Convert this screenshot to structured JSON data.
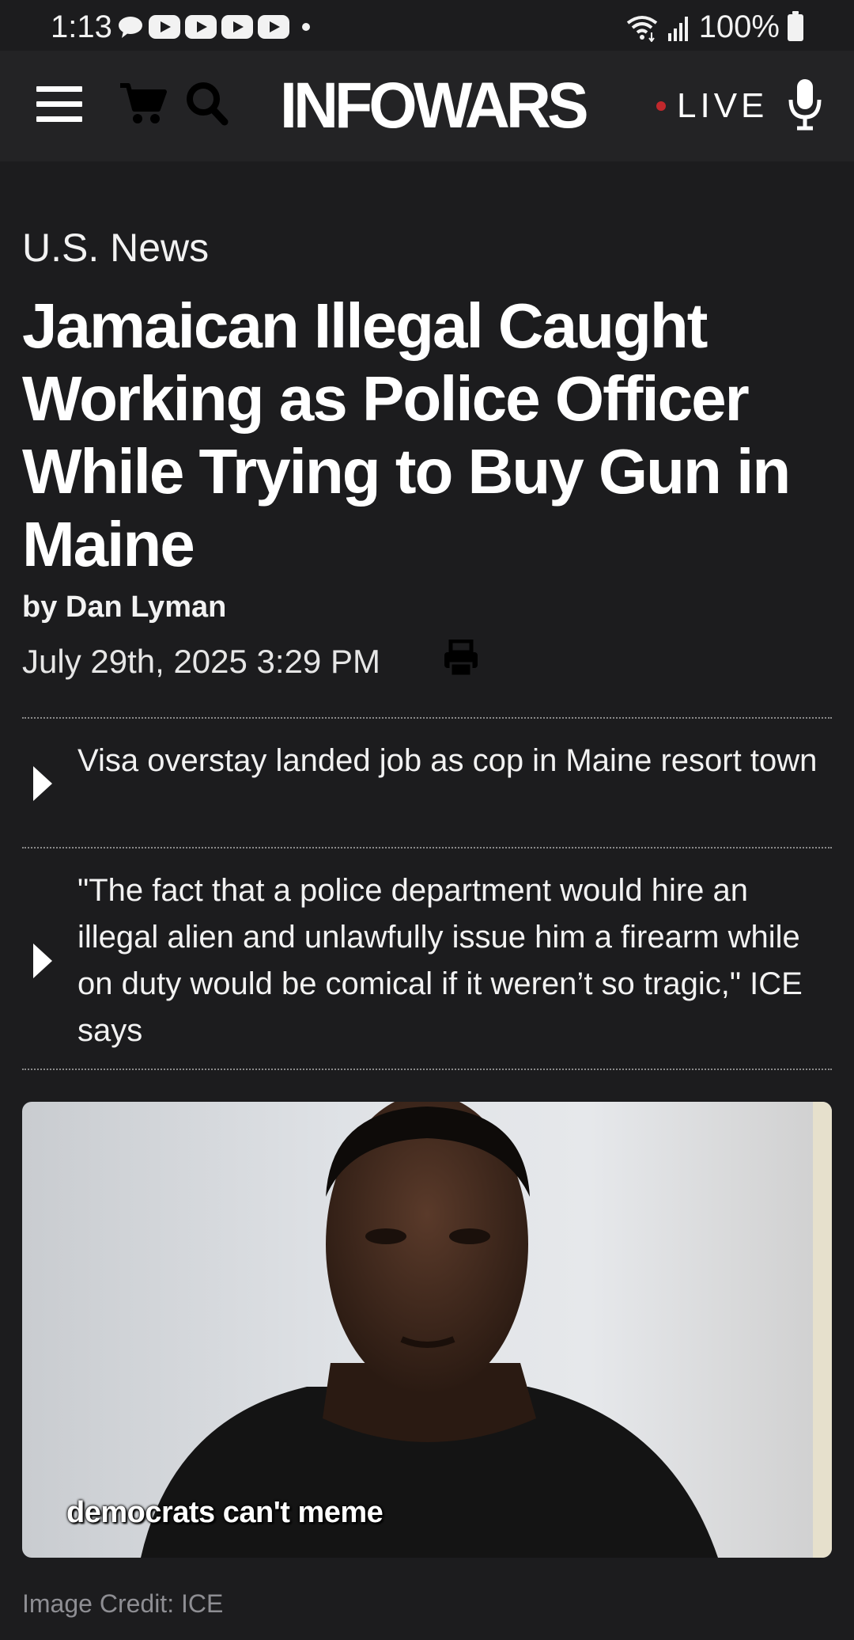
{
  "status_bar": {
    "time": "1:13",
    "battery": "100%",
    "notification_icons": [
      "chat-bubble-icon",
      "youtube-icon",
      "youtube-icon",
      "youtube-icon",
      "youtube-icon",
      "dot-icon"
    ],
    "system_icons": [
      "wifi-icon",
      "signal-icon",
      "battery-icon"
    ]
  },
  "header": {
    "logo": "INFOWARS",
    "live_label": "LIVE",
    "icons": [
      "menu-icon",
      "cart-icon",
      "search-icon",
      "microphone-icon"
    ],
    "live_dot_color": "#c0282c"
  },
  "article": {
    "category": "U.S. News",
    "headline": "Jamaican Illegal Caught Working as Police Officer While Trying to Buy Gun in Maine",
    "byline_prefix": "by ",
    "author": "Dan Lyman",
    "date": "July 29th, 2025 3:29 PM",
    "bullets": [
      "Visa overstay landed job as cop in Maine resort town",
      "\"The fact that a police department would hire an illegal alien and unlawfully issue him a firearm while on duty would be comical if it weren’t so tragic,\" ICE says"
    ],
    "image_caption": "democrats can't meme",
    "image_credit": "Image Credit: ICE"
  },
  "colors": {
    "background": "#1c1c1e",
    "header_background": "#232325",
    "text": "#ffffff",
    "muted_text": "#8e8e93"
  }
}
